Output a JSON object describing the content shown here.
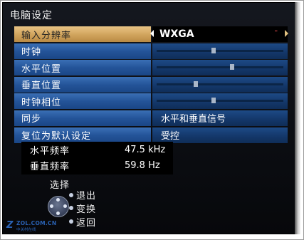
{
  "window": {
    "title": "电脑设定"
  },
  "menu": {
    "rows": [
      {
        "label": "输入分辨率",
        "value": "WXGA",
        "selected": true
      },
      {
        "label": "时钟",
        "slider_level": 0.45
      },
      {
        "label": "水平位置",
        "slider_level": 0.6
      },
      {
        "label": "垂直位置",
        "slider_level": 0.3
      },
      {
        "label": "时钟相位",
        "slider_level": 0.45
      },
      {
        "label": "同步",
        "value": "水平和垂直信号"
      },
      {
        "label": "复位为默认设定",
        "value": "受控"
      }
    ],
    "selected_minus_mark": "–"
  },
  "info": {
    "h_freq_label": "水平频率",
    "h_freq_value": "47.5 kHz",
    "v_freq_label": "垂直频率",
    "v_freq_value": "59.8 Hz"
  },
  "legend": {
    "select_label": "选择",
    "exit_label": "退出",
    "change_label": "变换",
    "back_label": "返回"
  },
  "watermark": {
    "logo_text": "ZOL.COM.CN",
    "sub_text": "中关村在线"
  },
  "colors": {
    "row_blue": "#245499",
    "row_selected": "#d0a35c",
    "screen_bg": "#0c0e13"
  }
}
